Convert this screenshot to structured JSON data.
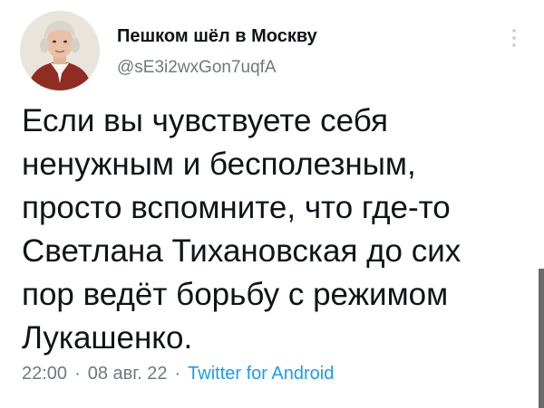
{
  "author": {
    "display_name": "Пешком шёл в Москву",
    "handle": "@sE3i2wxGon7uqfA",
    "avatar_icon": "portrait-avatar"
  },
  "tweet": {
    "lines": [
      "Если вы чувствуете себя",
      "ненужным и бесполезным,",
      "просто вспомните, что где-то",
      "Светлана Тихановская до сих",
      "пор ведёт борьбу с режимом",
      "Лукашенко."
    ],
    "time": "22:00",
    "date": "08 авг. 22",
    "source": "Twitter for Android",
    "separator": "·"
  },
  "icons": {
    "more": "more-vertical-icon"
  },
  "colors": {
    "text": "#0f1419",
    "secondary": "#6e7880",
    "link": "#1d9bf0"
  }
}
